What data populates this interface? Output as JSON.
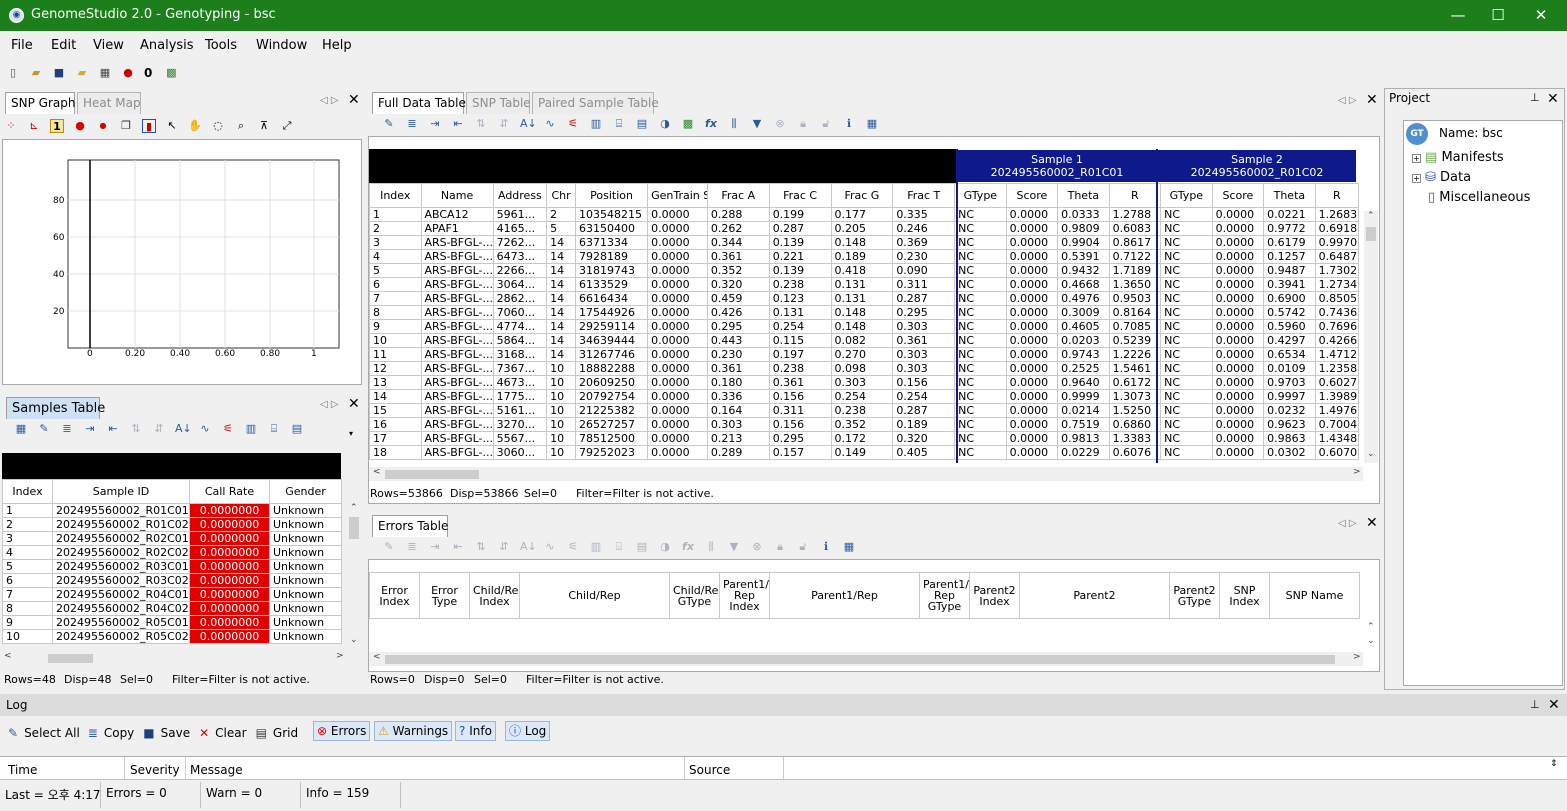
{
  "window": {
    "title": "GenomeStudio 2.0 - Genotyping - bsc",
    "minimize": "—",
    "maximize": "☐",
    "close": "✕"
  },
  "menu": [
    "File",
    "Edit",
    "View",
    "Analysis",
    "Tools",
    "Window",
    "Help"
  ],
  "toolbar": {
    "counter": "0"
  },
  "snp_panel": {
    "tabs": [
      "SNP Graph",
      "Heat Map"
    ],
    "y_ticks": [
      "80",
      "60",
      "40",
      "20"
    ],
    "x_ticks": [
      "0",
      "0.20",
      "0.40",
      "0.60",
      "0.80",
      "1"
    ]
  },
  "samples_panel": {
    "tab": "Samples Table",
    "headers": [
      "Index",
      "Sample ID",
      "Call Rate",
      "Gender"
    ],
    "rows": [
      [
        "1",
        "202495560002_R01C01",
        "0.0000000",
        "Unknown"
      ],
      [
        "2",
        "202495560002_R01C02",
        "0.0000000",
        "Unknown"
      ],
      [
        "3",
        "202495560002_R02C01",
        "0.0000000",
        "Unknown"
      ],
      [
        "4",
        "202495560002_R02C02",
        "0.0000000",
        "Unknown"
      ],
      [
        "5",
        "202495560002_R03C01",
        "0.0000000",
        "Unknown"
      ],
      [
        "6",
        "202495560002_R03C02",
        "0.0000000",
        "Unknown"
      ],
      [
        "7",
        "202495560002_R04C01",
        "0.0000000",
        "Unknown"
      ],
      [
        "8",
        "202495560002_R04C02",
        "0.0000000",
        "Unknown"
      ],
      [
        "9",
        "202495560002_R05C01",
        "0.0000000",
        "Unknown"
      ],
      [
        "10",
        "202495560002_R05C02",
        "0.0000000",
        "Unknown"
      ]
    ],
    "status": {
      "rows": "Rows=48",
      "disp": "Disp=48",
      "sel": "Sel=0",
      "filter": "Filter=Filter is not active."
    }
  },
  "data_panel": {
    "tabs": [
      "Full Data Table",
      "SNP Table",
      "Paired Sample Table"
    ],
    "fx": "fx",
    "samples": [
      {
        "label": "Sample 1",
        "id": "202495560002_R01C01"
      },
      {
        "label": "Sample 2",
        "id": "202495560002_R01C02"
      }
    ],
    "headers": [
      "Index",
      "Name",
      "Address",
      "Chr",
      "Position",
      "GenTrain Score",
      "Frac A",
      "Frac C",
      "Frac G",
      "Frac T",
      "GType",
      "Score",
      "Theta",
      "R",
      "GType",
      "Score",
      "Theta",
      "R"
    ],
    "rows": [
      [
        "1",
        "ABCA12",
        "5961...",
        "2",
        "103548215",
        "0.0000",
        "0.288",
        "0.199",
        "0.177",
        "0.335",
        "NC",
        "0.0000",
        "0.0333",
        "1.2788",
        "NC",
        "0.0000",
        "0.0221",
        "1.2683"
      ],
      [
        "2",
        "APAF1",
        "4165...",
        "5",
        "63150400",
        "0.0000",
        "0.262",
        "0.287",
        "0.205",
        "0.246",
        "NC",
        "0.0000",
        "0.9809",
        "0.6083",
        "NC",
        "0.0000",
        "0.9772",
        "0.6918"
      ],
      [
        "3",
        "ARS-BFGL-...",
        "7262...",
        "14",
        "6371334",
        "0.0000",
        "0.344",
        "0.139",
        "0.148",
        "0.369",
        "NC",
        "0.0000",
        "0.9904",
        "0.8617",
        "NC",
        "0.0000",
        "0.6179",
        "0.9970"
      ],
      [
        "4",
        "ARS-BFGL-...",
        "6473...",
        "14",
        "7928189",
        "0.0000",
        "0.361",
        "0.221",
        "0.189",
        "0.230",
        "NC",
        "0.0000",
        "0.5391",
        "0.7122",
        "NC",
        "0.0000",
        "0.1257",
        "0.6487"
      ],
      [
        "5",
        "ARS-BFGL-...",
        "2266...",
        "14",
        "31819743",
        "0.0000",
        "0.352",
        "0.139",
        "0.418",
        "0.090",
        "NC",
        "0.0000",
        "0.9432",
        "1.7189",
        "NC",
        "0.0000",
        "0.9487",
        "1.7302"
      ],
      [
        "6",
        "ARS-BFGL-...",
        "3064...",
        "14",
        "6133529",
        "0.0000",
        "0.320",
        "0.238",
        "0.131",
        "0.311",
        "NC",
        "0.0000",
        "0.4668",
        "1.3650",
        "NC",
        "0.0000",
        "0.3941",
        "1.2734"
      ],
      [
        "7",
        "ARS-BFGL-...",
        "2862...",
        "14",
        "6616434",
        "0.0000",
        "0.459",
        "0.123",
        "0.131",
        "0.287",
        "NC",
        "0.0000",
        "0.4976",
        "0.9503",
        "NC",
        "0.0000",
        "0.6900",
        "0.8505"
      ],
      [
        "8",
        "ARS-BFGL-...",
        "7060...",
        "14",
        "17544926",
        "0.0000",
        "0.426",
        "0.131",
        "0.148",
        "0.295",
        "NC",
        "0.0000",
        "0.3009",
        "0.8164",
        "NC",
        "0.0000",
        "0.5742",
        "0.7436"
      ],
      [
        "9",
        "ARS-BFGL-...",
        "4774...",
        "14",
        "29259114",
        "0.0000",
        "0.295",
        "0.254",
        "0.148",
        "0.303",
        "NC",
        "0.0000",
        "0.4605",
        "0.7085",
        "NC",
        "0.0000",
        "0.5960",
        "0.7696"
      ],
      [
        "10",
        "ARS-BFGL-...",
        "5864...",
        "14",
        "34639444",
        "0.0000",
        "0.443",
        "0.115",
        "0.082",
        "0.361",
        "NC",
        "0.0000",
        "0.0203",
        "0.5239",
        "NC",
        "0.0000",
        "0.4297",
        "0.4266"
      ],
      [
        "11",
        "ARS-BFGL-...",
        "3168...",
        "14",
        "31267746",
        "0.0000",
        "0.230",
        "0.197",
        "0.270",
        "0.303",
        "NC",
        "0.0000",
        "0.9743",
        "1.2226",
        "NC",
        "0.0000",
        "0.6534",
        "1.4712"
      ],
      [
        "12",
        "ARS-BFGL-...",
        "7367...",
        "10",
        "18882288",
        "0.0000",
        "0.361",
        "0.238",
        "0.098",
        "0.303",
        "NC",
        "0.0000",
        "0.2525",
        "1.5461",
        "NC",
        "0.0000",
        "0.0109",
        "1.2358"
      ],
      [
        "13",
        "ARS-BFGL-...",
        "4673...",
        "10",
        "20609250",
        "0.0000",
        "0.180",
        "0.361",
        "0.303",
        "0.156",
        "NC",
        "0.0000",
        "0.9640",
        "0.6172",
        "NC",
        "0.0000",
        "0.9703",
        "0.6027"
      ],
      [
        "14",
        "ARS-BFGL-...",
        "1775...",
        "10",
        "20792754",
        "0.0000",
        "0.336",
        "0.156",
        "0.254",
        "0.254",
        "NC",
        "0.0000",
        "0.9999",
        "1.3073",
        "NC",
        "0.0000",
        "0.9997",
        "1.3989"
      ],
      [
        "15",
        "ARS-BFGL-...",
        "5161...",
        "10",
        "21225382",
        "0.0000",
        "0.164",
        "0.311",
        "0.238",
        "0.287",
        "NC",
        "0.0000",
        "0.0214",
        "1.5250",
        "NC",
        "0.0000",
        "0.0232",
        "1.4976"
      ],
      [
        "16",
        "ARS-BFGL-...",
        "3270...",
        "10",
        "26527257",
        "0.0000",
        "0.303",
        "0.156",
        "0.352",
        "0.189",
        "NC",
        "0.0000",
        "0.7519",
        "0.6860",
        "NC",
        "0.0000",
        "0.9623",
        "0.7004"
      ],
      [
        "17",
        "ARS-BFGL-...",
        "5567...",
        "10",
        "78512500",
        "0.0000",
        "0.213",
        "0.295",
        "0.172",
        "0.320",
        "NC",
        "0.0000",
        "0.9813",
        "1.3383",
        "NC",
        "0.0000",
        "0.9863",
        "1.4348"
      ],
      [
        "18",
        "ARS-BFGL-...",
        "3060...",
        "10",
        "79252023",
        "0.0000",
        "0.289",
        "0.157",
        "0.149",
        "0.405",
        "NC",
        "0.0000",
        "0.0229",
        "0.6076",
        "NC",
        "0.0000",
        "0.0302",
        "0.6070"
      ]
    ],
    "status": {
      "rows": "Rows=53866",
      "disp": "Disp=53866",
      "sel": "Sel=0",
      "filter": "Filter=Filter is not active."
    }
  },
  "errors_panel": {
    "tab": "Errors Table",
    "fx": "fx",
    "headers": [
      "Error Index",
      "Error Type",
      "Child/Rep Index",
      "Child/Rep",
      "Child/Rep GType",
      "Parent1/ Rep Index",
      "Parent1/Rep",
      "Parent1/ Rep GType",
      "Parent2 Index",
      "Parent2",
      "Parent2 GType",
      "SNP Index",
      "SNP Name"
    ],
    "status": {
      "rows": "Rows=0",
      "disp": "Disp=0",
      "sel": "Sel=0",
      "filter": "Filter=Filter is not active."
    }
  },
  "project_panel": {
    "title": "Project",
    "badge": "GT",
    "name": "Name: bsc",
    "items": [
      "Manifests",
      "Data",
      "Miscellaneous"
    ]
  },
  "log_panel": {
    "title": "Log",
    "buttons": [
      "Select All",
      "Copy",
      "Save",
      "Clear",
      "Grid",
      "Errors",
      "Warnings",
      "Info",
      "Log"
    ],
    "columns": [
      "Time",
      "Severity",
      "Message",
      "Source"
    ]
  },
  "statusbar": {
    "last": "Last = 오후 4:17",
    "errors": "Errors = 0",
    "warn": "Warn = 0",
    "info": "Info = 159"
  },
  "colors": {
    "title_green": "#1c7f1c",
    "sample_header": "#0e1a8c",
    "call_rate_red": "#e00000"
  }
}
